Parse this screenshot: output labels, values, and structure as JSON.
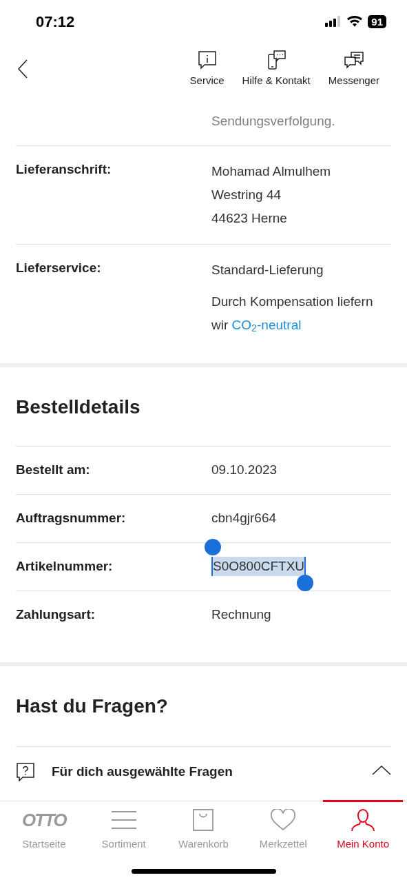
{
  "status_bar": {
    "time": "07:12",
    "battery": "91"
  },
  "header": {
    "actions": [
      {
        "label": "Service"
      },
      {
        "label": "Hilfe & Kontakt"
      },
      {
        "label": "Messenger"
      }
    ]
  },
  "tracking_note": "Sendungsverfolgung.",
  "delivery": [
    {
      "label": "Lieferanschrift:",
      "lines": [
        "Mohamad Almulhem",
        "Westring 44",
        "44623 Herne"
      ]
    },
    {
      "label": "Lieferservice:",
      "lines": [
        "Standard-Lieferung"
      ],
      "note": "Durch Kompensation liefern wir",
      "note_link": "CO$_{2}$-neutral"
    }
  ],
  "order_details": {
    "title": "Bestelldetails",
    "rows": [
      {
        "label": "Bestellt am:",
        "value": "09.10.2023",
        "text_selected": false
      },
      {
        "label": "Auftragsnummer:",
        "value": "cbn4gjr664",
        "text_selected": false
      },
      {
        "label": "Artikelnummer:",
        "value": "S0O800CFTXU",
        "text_selected": true
      },
      {
        "label": "Zahlungsart:",
        "value": "Rechnung",
        "text_selected": false
      }
    ]
  },
  "questions": {
    "title": "Hast du Fragen?",
    "accordion": {
      "label": "Für dich ausgewählte Fragen",
      "expanded": true
    }
  },
  "tab_bar": [
    {
      "label": "Startseite",
      "logo": "OTTO",
      "selected": false
    },
    {
      "label": "Sortiment",
      "selected": false
    },
    {
      "label": "Warenkorb",
      "selected": false
    },
    {
      "label": "Merkzettel",
      "selected": false
    },
    {
      "label": "Mein Konto",
      "selected": true
    }
  ]
}
